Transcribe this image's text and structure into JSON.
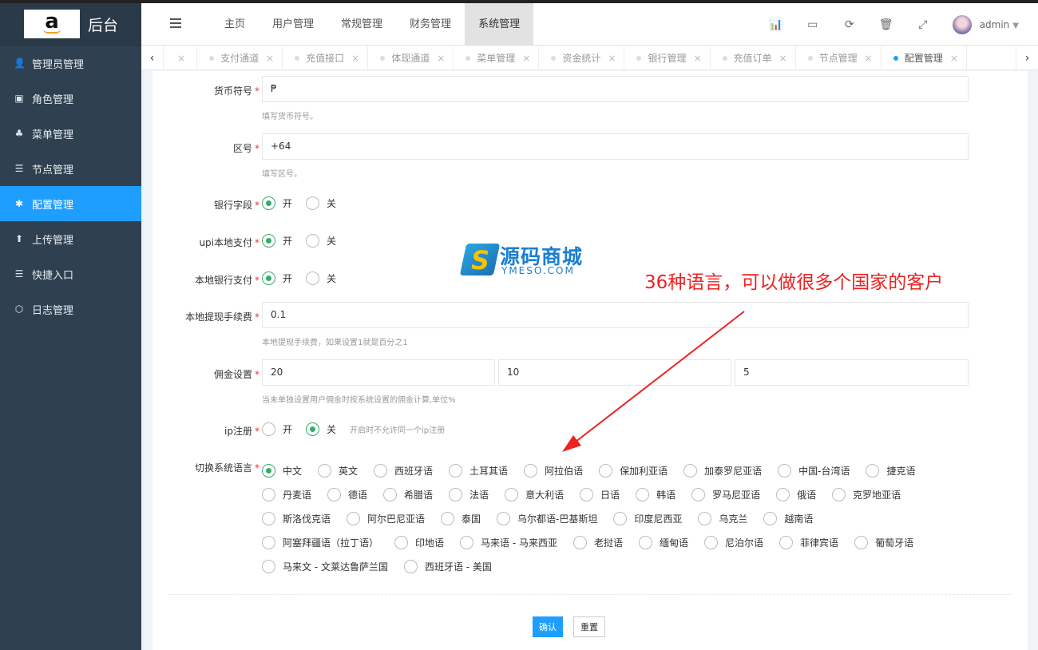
{
  "brand": {
    "logo_letter": "a",
    "title": "后台"
  },
  "sidebar": {
    "items": [
      {
        "label": "管理员管理",
        "icon": "user-icon",
        "glyph": "👤",
        "active": false
      },
      {
        "label": "角色管理",
        "icon": "id-card-icon",
        "glyph": "▣",
        "active": false
      },
      {
        "label": "菜单管理",
        "icon": "tree-icon",
        "glyph": "♣",
        "active": false
      },
      {
        "label": "节点管理",
        "icon": "list-icon",
        "glyph": "☰",
        "active": false
      },
      {
        "label": "配置管理",
        "icon": "gear-icon",
        "glyph": "✱",
        "active": true
      },
      {
        "label": "上传管理",
        "icon": "upload-icon",
        "glyph": "⬆",
        "active": false
      },
      {
        "label": "快捷入口",
        "icon": "list-icon",
        "glyph": "☰",
        "active": false
      },
      {
        "label": "日志管理",
        "icon": "cube-icon",
        "glyph": "⬡",
        "active": false
      }
    ]
  },
  "header": {
    "menu": [
      {
        "label": "主页",
        "active": false
      },
      {
        "label": "用户管理",
        "active": false
      },
      {
        "label": "常规管理",
        "active": false
      },
      {
        "label": "财务管理",
        "active": false
      },
      {
        "label": "系统管理",
        "active": true
      }
    ],
    "icons": [
      {
        "name": "chart-icon",
        "glyph": "📊"
      },
      {
        "name": "card-icon",
        "glyph": "▭"
      },
      {
        "name": "refresh-icon",
        "glyph": "⟳"
      },
      {
        "name": "trash-icon",
        "glyph": "🗑"
      },
      {
        "name": "fullscreen-icon",
        "glyph": "⤢"
      }
    ],
    "user": "admin"
  },
  "tabs": [
    {
      "label": "支付通道",
      "active": false
    },
    {
      "label": "充值接口",
      "active": false
    },
    {
      "label": "体现通道",
      "active": false
    },
    {
      "label": "菜单管理",
      "active": false
    },
    {
      "label": "资金统计",
      "active": false
    },
    {
      "label": "银行管理",
      "active": false
    },
    {
      "label": "充值订单",
      "active": false
    },
    {
      "label": "节点管理",
      "active": false
    },
    {
      "label": "配置管理",
      "active": true
    }
  ],
  "form": {
    "currency": {
      "label": "货币符号",
      "value": "₱",
      "hint": "填写货币符号。"
    },
    "area_code": {
      "label": "区号",
      "value": "+64",
      "hint": "填写区号。"
    },
    "bank_field": {
      "label": "银行字段",
      "on": "开",
      "off": "关",
      "selected": "on"
    },
    "upi_local_pay": {
      "label": "upi本地支付",
      "on": "开",
      "off": "关",
      "selected": "on"
    },
    "local_bank_pay": {
      "label": "本地银行支付",
      "on": "开",
      "off": "关",
      "selected": "on"
    },
    "withdraw_fee": {
      "label": "本地提现手续费",
      "value": "0.1",
      "hint": "本地提现手续费，如果设置1就是百分之1"
    },
    "commission": {
      "label": "佣金设置",
      "values": [
        "20",
        "10",
        "5"
      ],
      "hint": "当未单独设置用户佣金时按系统设置的佣金计算,单位%"
    },
    "ip_register": {
      "label": "ip注册",
      "on": "开",
      "off": "关",
      "selected": "off",
      "hint": "开启时不允许同一个ip注册"
    },
    "language": {
      "label": "切换系统语言",
      "selected": "中文",
      "rows": [
        [
          "中文",
          "英文",
          "西班牙语",
          "土耳其语",
          "阿拉伯语",
          "保加利亚语",
          "加泰罗尼亚语",
          "中国-台湾语",
          "捷克语"
        ],
        [
          "丹麦语",
          "德语",
          "希腊语",
          "法语",
          "意大利语",
          "日语",
          "韩语",
          "罗马尼亚语",
          "俄语",
          "克罗地亚语"
        ],
        [
          "斯洛伐克语",
          "阿尔巴尼亚语",
          "泰国",
          "乌尔都语-巴基斯坦",
          "印度尼西亚",
          "乌克兰",
          "越南语"
        ],
        [
          "阿塞拜疆语（拉丁语）",
          "印地语",
          "马来语 - 马来西亚",
          "老挝语",
          "缅甸语",
          "尼泊尔语",
          "菲律宾语",
          "葡萄牙语"
        ],
        [
          "马来文 - 文莱达鲁萨兰国",
          "西班牙语 - 美国"
        ]
      ]
    },
    "submit": "确认",
    "reset": "重置"
  },
  "watermark": {
    "letter": "S",
    "title": "源码商城",
    "sub": "YMESO.COM"
  },
  "annotation": "36种语言，可以做很多个国家的客户"
}
